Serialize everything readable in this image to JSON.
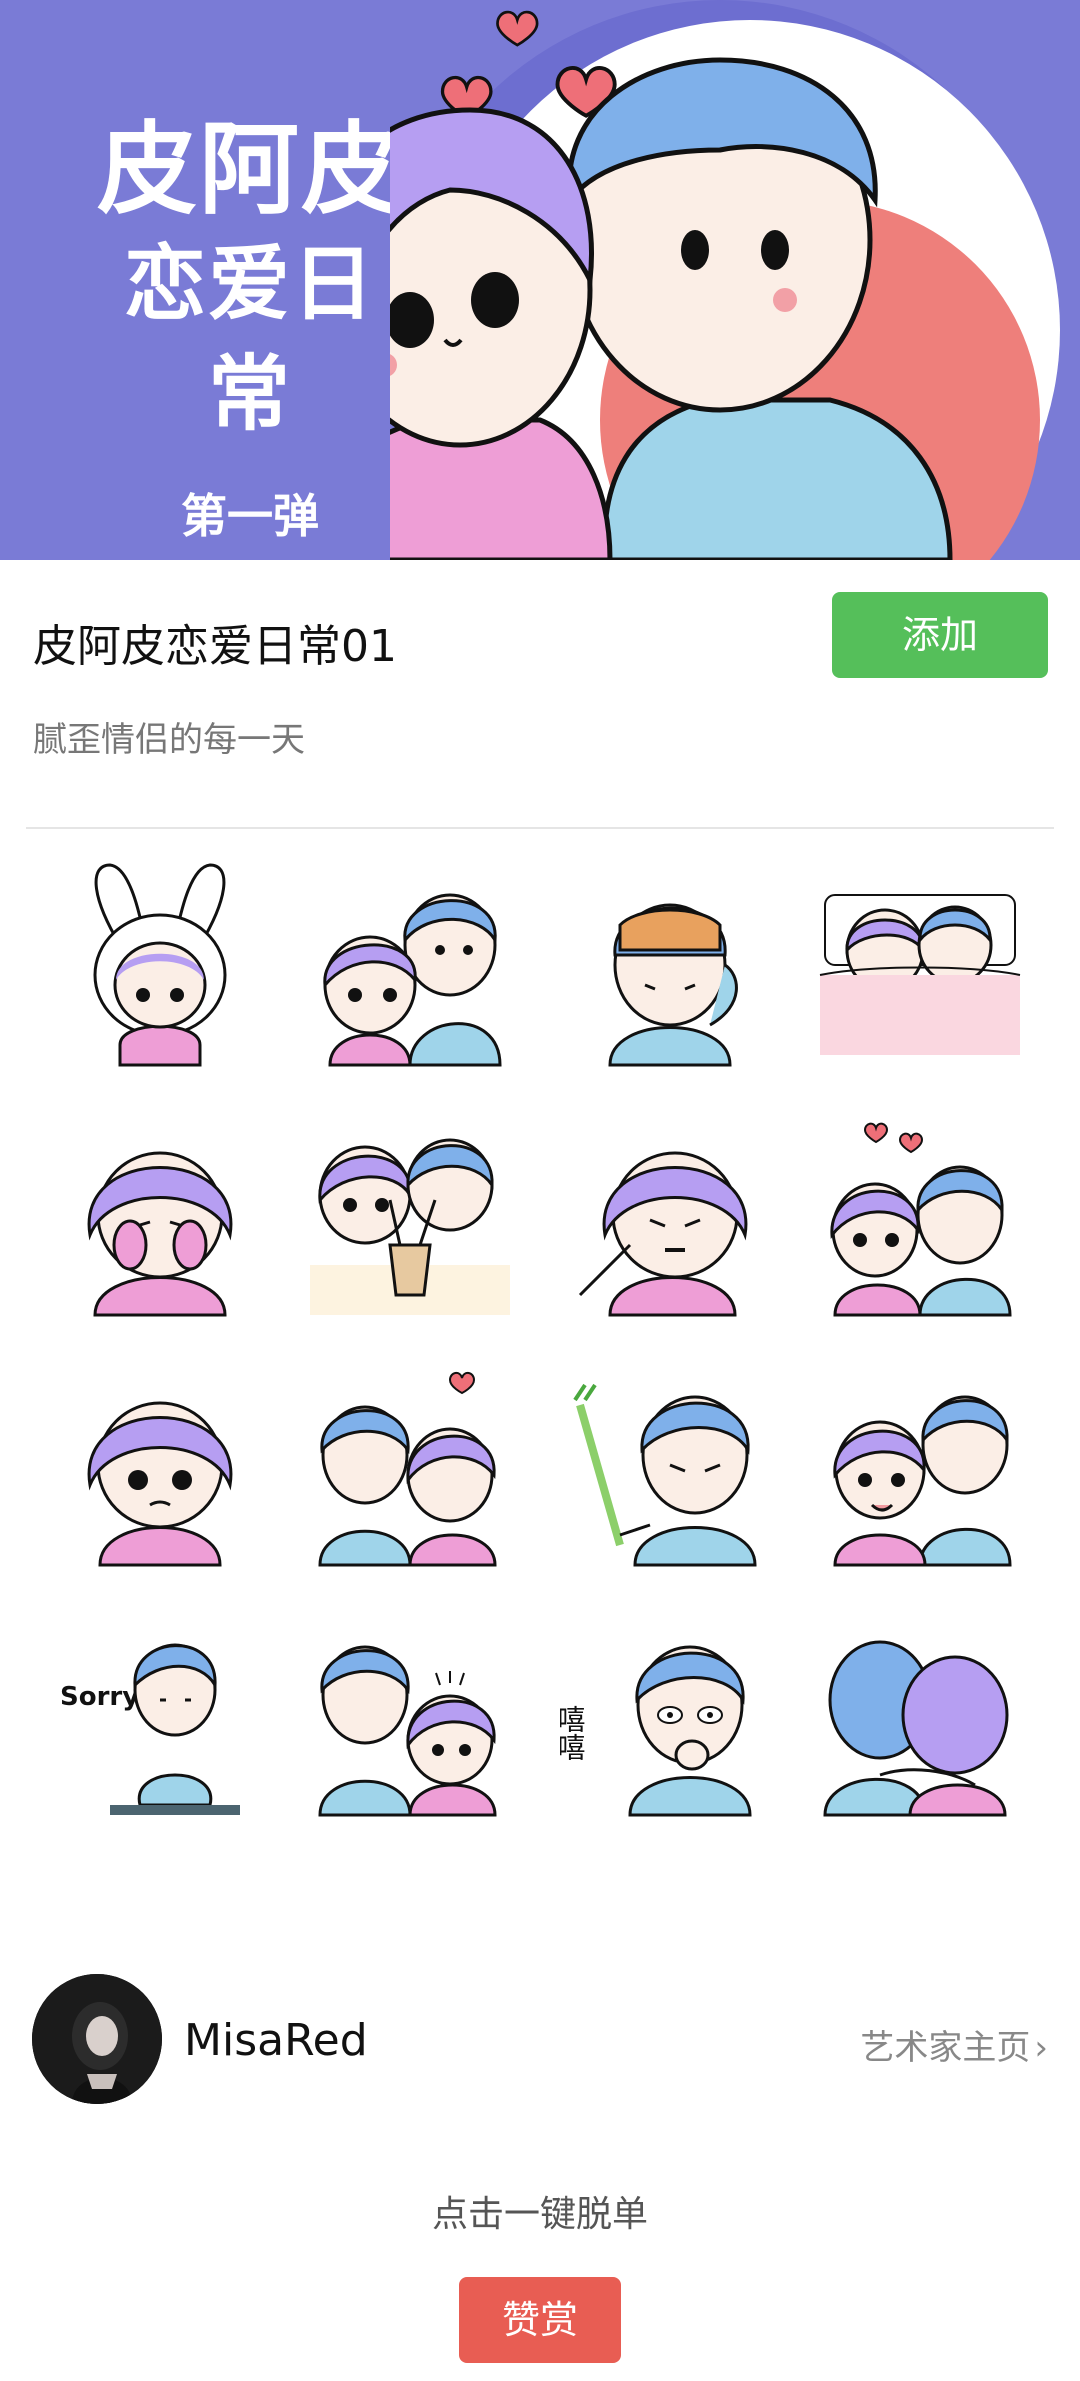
{
  "banner": {
    "title_line1": "皮阿皮",
    "title_line2": "恋爱日常",
    "title_line3": "第一弹",
    "bg_color": "#7a7bd6"
  },
  "pack": {
    "title": "皮阿皮恋爱日常01",
    "description": "腻歪情侣的每一天",
    "add_label": "添加",
    "add_color": "#55bf5a"
  },
  "stickers": [
    {
      "icon": "bunny-hood-girl-icon"
    },
    {
      "icon": "couple-hug-icon"
    },
    {
      "icon": "boy-sleep-mask-icon"
    },
    {
      "icon": "couple-in-bed-icon"
    },
    {
      "icon": "girl-shy-icon"
    },
    {
      "icon": "couple-bubble-tea-icon"
    },
    {
      "icon": "girl-pout-icon"
    },
    {
      "icon": "couple-hearts-icon"
    },
    {
      "icon": "girl-sad-icon"
    },
    {
      "icon": "couple-kiss-icon"
    },
    {
      "icon": "boy-angry-leek-icon"
    },
    {
      "icon": "couple-cuddle-icon"
    },
    {
      "icon": "boy-sorry-icon"
    },
    {
      "icon": "couple-surprised-icon"
    },
    {
      "icon": "boy-giggle-icon"
    },
    {
      "icon": "couple-back-hug-icon"
    }
  ],
  "sticker_texts": {
    "sorry": "Sorry",
    "giggle": "嘻嘻"
  },
  "artist": {
    "name": "MisaRed",
    "link_label": "艺术家主页",
    "chevron": "›"
  },
  "reward": {
    "hint": "点击一键脱单",
    "button_label": "赞赏",
    "button_color": "#e85d53"
  }
}
